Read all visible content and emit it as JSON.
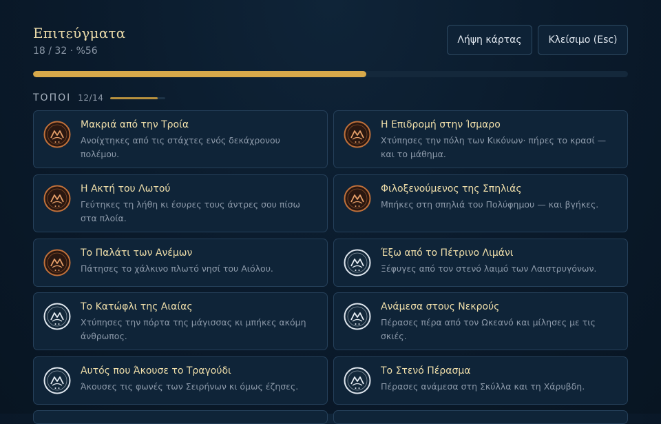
{
  "header": {
    "title": "Επιτεύγματα",
    "stats": "18 / 32 · %56",
    "progress": 0.56
  },
  "toolbar": {
    "card_label": "Λήψη κάρτας",
    "close_label": "Κλείσιμο (Esc)"
  },
  "section": {
    "name": "ΤΟΠΟΙ",
    "count": "12/14",
    "progress": 0.857
  },
  "colors": {
    "accent": "#d8a94a",
    "bronze": "#c0703a",
    "silver": "#dfe6ee",
    "card_bg": "#0f2438",
    "card_border": "#25405a"
  },
  "achievements": [
    {
      "title": "Μακριά από την Τροία",
      "desc": "Ανοίχτηκες από τις στάχτες ενός δεκάχρονου πολέμου.",
      "tier": "bronze",
      "icon": "laurel-badge-icon"
    },
    {
      "title": "Η Επιδρομή στην Ίσμαρο",
      "desc": "Χτύπησες την πόλη των Κικόνων· πήρες το κρασί — και το μάθημα.",
      "tier": "bronze",
      "icon": "laurel-badge-icon"
    },
    {
      "title": "Η Ακτή του Λωτού",
      "desc": "Γεύτηκες τη λήθη κι έσυρες τους άντρες σου πίσω στα πλοία.",
      "tier": "bronze",
      "icon": "laurel-badge-icon"
    },
    {
      "title": "Φιλοξενούμενος της Σπηλιάς",
      "desc": "Μπήκες στη σπηλιά του Πολύφημου — και βγήκες.",
      "tier": "bronze",
      "icon": "laurel-badge-icon"
    },
    {
      "title": "Το Παλάτι των Ανέμων",
      "desc": "Πάτησες το χάλκινο πλωτό νησί του Αιόλου.",
      "tier": "bronze",
      "icon": "laurel-badge-icon"
    },
    {
      "title": "Έξω από το Πέτρινο Λιμάνι",
      "desc": "Ξέφυγες από τον στενό λαιμό των Λαιστρυγόνων.",
      "tier": "silver",
      "icon": "laurel-badge-icon"
    },
    {
      "title": "Το Κατώφλι της Αιαίας",
      "desc": "Χτύπησες την πόρτα της μάγισσας κι μπήκες ακόμη άνθρωπος.",
      "tier": "silver",
      "icon": "laurel-badge-icon"
    },
    {
      "title": "Ανάμεσα στους Νεκρούς",
      "desc": "Πέρασες πέρα από τον Ωκεανό και μίλησες με τις σκιές.",
      "tier": "silver",
      "icon": "laurel-badge-icon"
    },
    {
      "title": "Αυτός που Άκουσε το Τραγούδι",
      "desc": "Άκουσες τις φωνές των Σειρήνων κι όμως έζησες.",
      "tier": "silver",
      "icon": "laurel-badge-icon"
    },
    {
      "title": "Το Στενό Πέρασμα",
      "desc": "Πέρασες ανάμεσα στη Σκύλλα και τη Χάρυβδη.",
      "tier": "silver",
      "icon": "laurel-badge-icon"
    },
    {
      "title": "",
      "desc": "",
      "tier": "silver",
      "icon": "laurel-badge-icon"
    },
    {
      "title": "",
      "desc": "",
      "tier": "silver",
      "icon": "laurel-badge-icon"
    }
  ]
}
